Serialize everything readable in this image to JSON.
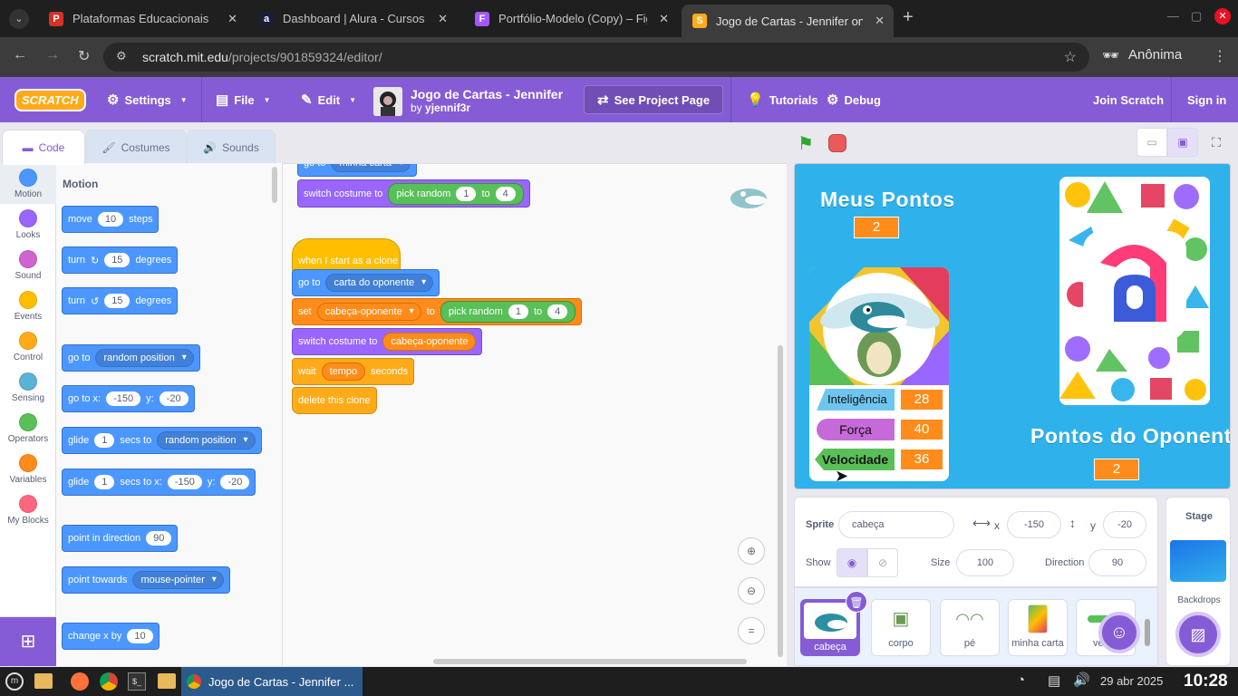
{
  "browser": {
    "tabs": [
      {
        "title": "Plataformas Educacionais",
        "color": "#d93025",
        "letter": "P"
      },
      {
        "title": "Dashboard | Alura - Cursos on",
        "color": "#1a1d3a",
        "letter": "a"
      },
      {
        "title": "Portfólio-Modelo (Copy) – Fig",
        "color": "#a259ff",
        "letter": "F"
      },
      {
        "title": "Jogo de Cartas - Jennifer on",
        "color": "#ffab19",
        "letter": "S"
      }
    ],
    "new_tab": "+",
    "url_host": "scratch.mit.edu",
    "url_path": "/projects/901859324/editor/",
    "profile": "Anônima"
  },
  "menu": {
    "logo": "SCRATCH",
    "settings": "Settings",
    "file": "File",
    "edit": "Edit",
    "project_title": "Jogo de Cartas - Jennifer",
    "by": "by",
    "author": "yjennif3r",
    "see_project": "See Project Page",
    "tutorials": "Tutorials",
    "debug": "Debug",
    "join": "Join Scratch",
    "signin": "Sign in"
  },
  "editor_tabs": {
    "code": "Code",
    "costumes": "Costumes",
    "sounds": "Sounds"
  },
  "categories": [
    {
      "label": "Motion",
      "color": "#4c97ff"
    },
    {
      "label": "Looks",
      "color": "#9966ff"
    },
    {
      "label": "Sound",
      "color": "#cf63cf"
    },
    {
      "label": "Events",
      "color": "#ffbf00"
    },
    {
      "label": "Control",
      "color": "#ffab19"
    },
    {
      "label": "Sensing",
      "color": "#5cb1d6"
    },
    {
      "label": "Operators",
      "color": "#59c059"
    },
    {
      "label": "Variables",
      "color": "#ff8c1a"
    },
    {
      "label": "My Blocks",
      "color": "#ff6680"
    }
  ],
  "palette": {
    "heading": "Motion",
    "move": {
      "a": "move",
      "n": "10",
      "b": "steps"
    },
    "turn_cw": {
      "a": "turn",
      "n": "15",
      "b": "degrees"
    },
    "turn_ccw": {
      "a": "turn",
      "n": "15",
      "b": "degrees"
    },
    "goto": {
      "a": "go to",
      "dd": "random position"
    },
    "gotoxy": {
      "a": "go to x:",
      "x": "-150",
      "y_label": "y:",
      "y": "-20"
    },
    "glide1": {
      "a": "glide",
      "n": "1",
      "b": "secs to",
      "dd": "random position"
    },
    "glide2": {
      "a": "glide",
      "n": "1",
      "b": "secs to x:",
      "x": "-150",
      "y_label": "y:",
      "y": "-20"
    },
    "point_dir": {
      "a": "point in direction",
      "n": "90"
    },
    "point_towards": {
      "a": "point towards",
      "dd": "mouse-pointer"
    },
    "change_x": {
      "a": "change x by",
      "n": "10"
    }
  },
  "script1": {
    "goto_dd": "minha carta",
    "switch": "switch costume to",
    "pick": "pick random",
    "n1": "1",
    "to": "to",
    "n2": "4"
  },
  "script2": {
    "hat": "when I start as a clone",
    "goto": "go to",
    "goto_dd": "carta do oponente",
    "set": "set",
    "set_dd": "cabeça-oponente",
    "set_to": "to",
    "pick": "pick random",
    "n1": "1",
    "to": "to",
    "n2": "4",
    "switch": "switch costume to",
    "switch_var": "cabeça-oponente",
    "wait": "wait",
    "wait_var": "tempo",
    "wait_b": "seconds",
    "delete": "delete this clone"
  },
  "stage": {
    "meus_pontos": "Meus Pontos",
    "meus_pontos_val": "2",
    "oponente": "Pontos do Oponente",
    "oponente_val": "2",
    "stats": [
      {
        "label": "Inteligência",
        "value": "28",
        "color": "#6ec6f0"
      },
      {
        "label": "Força",
        "value": "40",
        "color": "#c76ad9"
      },
      {
        "label": "Velocidade",
        "value": "36",
        "color": "#59c059"
      }
    ]
  },
  "sprite_info": {
    "sprite_label": "Sprite",
    "sprite_name": "cabeça",
    "x_label": "x",
    "x": "-150",
    "y_label": "y",
    "y": "-20",
    "show": "Show",
    "size_label": "Size",
    "size": "100",
    "dir_label": "Direction",
    "dir": "90"
  },
  "sprites": [
    "cabeça",
    "corpo",
    "pé",
    "minha carta",
    "veloci"
  ],
  "stage_pane": {
    "title": "Stage",
    "backdrops": "Backdrops"
  },
  "taskbar": {
    "window": "Jogo de Cartas - Jennifer ...",
    "date": "29 abr 2025",
    "time": "10:28"
  }
}
